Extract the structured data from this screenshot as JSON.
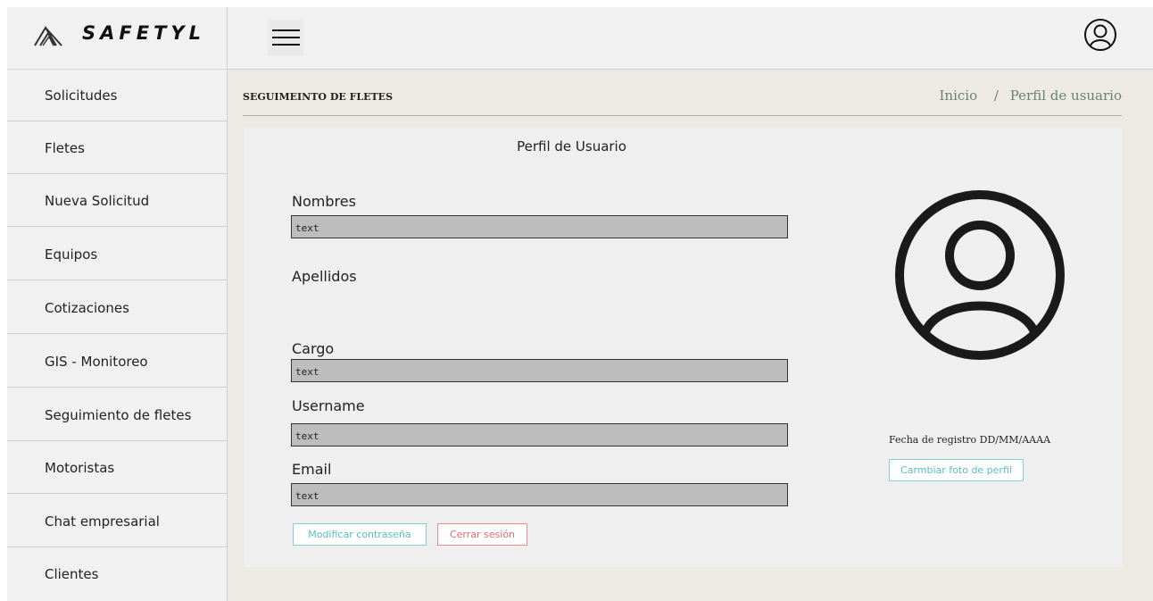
{
  "app": {
    "logo_text": "SAFETYL"
  },
  "sidebar": {
    "items": [
      {
        "label": "Solicitudes"
      },
      {
        "label": "Fletes"
      },
      {
        "label": "Nueva Solicitud"
      },
      {
        "label": "Equipos"
      },
      {
        "label": "Cotizaciones"
      },
      {
        "label": "GIS - Monitoreo"
      },
      {
        "label": "Seguimiento de fletes"
      },
      {
        "label": "Motoristas"
      },
      {
        "label": "Chat empresarial"
      },
      {
        "label": "Clientes"
      }
    ]
  },
  "header": {
    "menu_icon": "hamburger-icon",
    "user_icon": "user-circle-icon"
  },
  "page": {
    "section_title": "SEGUIMEINTO DE FLETES",
    "breadcrumb": {
      "home": "Inicio",
      "separator": "/",
      "current": "Perfil de usuario"
    }
  },
  "profile": {
    "title": "Perfil de Usuario",
    "fields": {
      "nombres": {
        "label": "Nombres",
        "value": "text"
      },
      "apellidos": {
        "label": "Apellidos"
      },
      "cargo": {
        "label": "Cargo",
        "value": "text"
      },
      "username": {
        "label": "Username",
        "value": "text"
      },
      "email": {
        "label": "Email",
        "value": "text"
      }
    },
    "buttons": {
      "change_password": "Modificar contraseña",
      "logout": "Cerrar sesión",
      "change_photo": "Carmbiar foto de perfil"
    },
    "registration_date": "Fecha de registro DD/MM/AAAA"
  },
  "colors": {
    "sidebar_bg": "#f1f1f1",
    "main_bg": "#edeae4",
    "card_bg": "#efefef",
    "input_bg": "#bdbdbd",
    "accent_cyan": "#5bbfc4",
    "accent_red": "#e86a6a",
    "breadcrumb": "#6c8176"
  }
}
